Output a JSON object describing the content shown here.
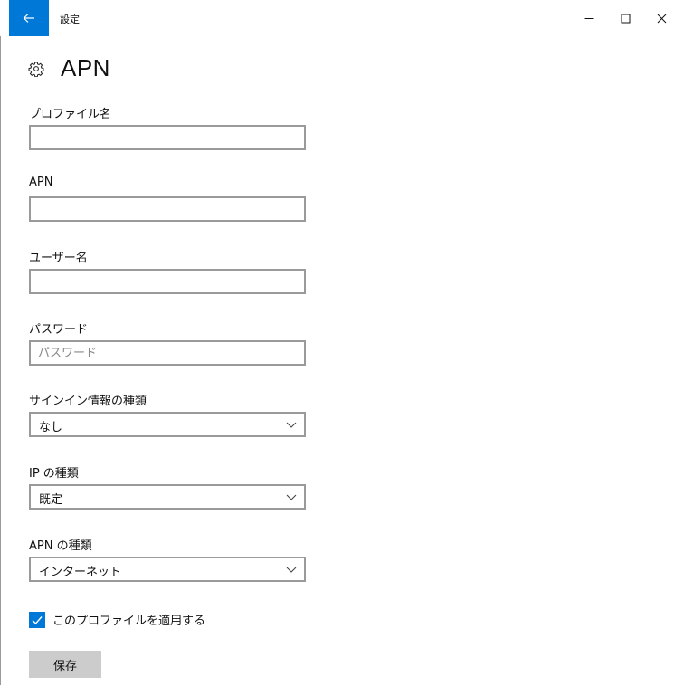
{
  "window": {
    "app_title": "設定",
    "accent": "#0078d7",
    "controls": [
      "minimize",
      "maximize",
      "close"
    ]
  },
  "header": {
    "icon": "gear-icon",
    "title": "APN"
  },
  "form": {
    "profile_name": {
      "label": "プロファイル名",
      "value": "",
      "placeholder": ""
    },
    "apn": {
      "label": "APN",
      "value": "",
      "placeholder": ""
    },
    "username": {
      "label": "ユーザー名",
      "value": "",
      "placeholder": ""
    },
    "password": {
      "label": "パスワード",
      "value": "",
      "placeholder": "パスワード"
    },
    "signin_type": {
      "label": "サインイン情報の種類",
      "selected": "なし"
    },
    "ip_type": {
      "label": "IP の種類",
      "selected": "既定"
    },
    "apn_type": {
      "label": "APN の種類",
      "selected": "インターネット"
    },
    "apply_profile": {
      "label": "このプロファイルを適用する",
      "checked": true
    },
    "save_label": "保存"
  }
}
